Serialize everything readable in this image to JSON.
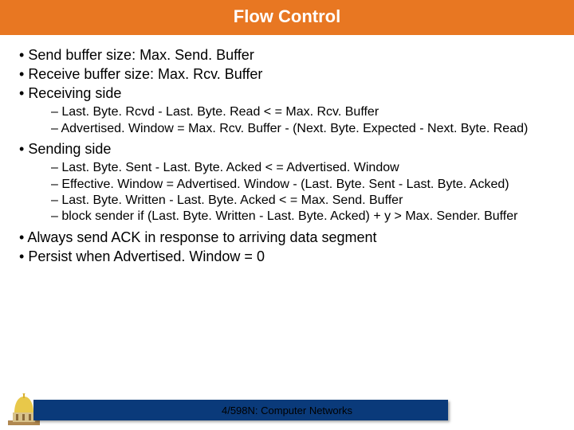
{
  "title": "Flow Control",
  "bullets": {
    "b1": "Send buffer size: Max. Send. Buffer",
    "b2": "Receive buffer size: Max. Rcv. Buffer",
    "b3": "Receiving side",
    "b3sub": {
      "s1": "Last. Byte. Rcvd - Last. Byte. Read < = Max. Rcv. Buffer",
      "s2": "Advertised. Window = Max. Rcv. Buffer - (Next. Byte. Expected - Next. Byte. Read)"
    },
    "b4": "Sending side",
    "b4sub": {
      "s1": "Last. Byte. Sent - Last. Byte. Acked < = Advertised. Window",
      "s2": "Effective. Window = Advertised. Window - (Last. Byte. Sent - Last. Byte. Acked)",
      "s3": "Last. Byte. Written - Last. Byte. Acked < = Max. Send. Buffer",
      "s4": "block sender if (Last. Byte. Written - Last. Byte. Acked) + y > Max. Sender. Buffer"
    },
    "b5": "Always send ACK in response to arriving data segment",
    "b6": "Persist when Advertised. Window = 0"
  },
  "footer": {
    "label": "4/598N: Computer Networks"
  }
}
